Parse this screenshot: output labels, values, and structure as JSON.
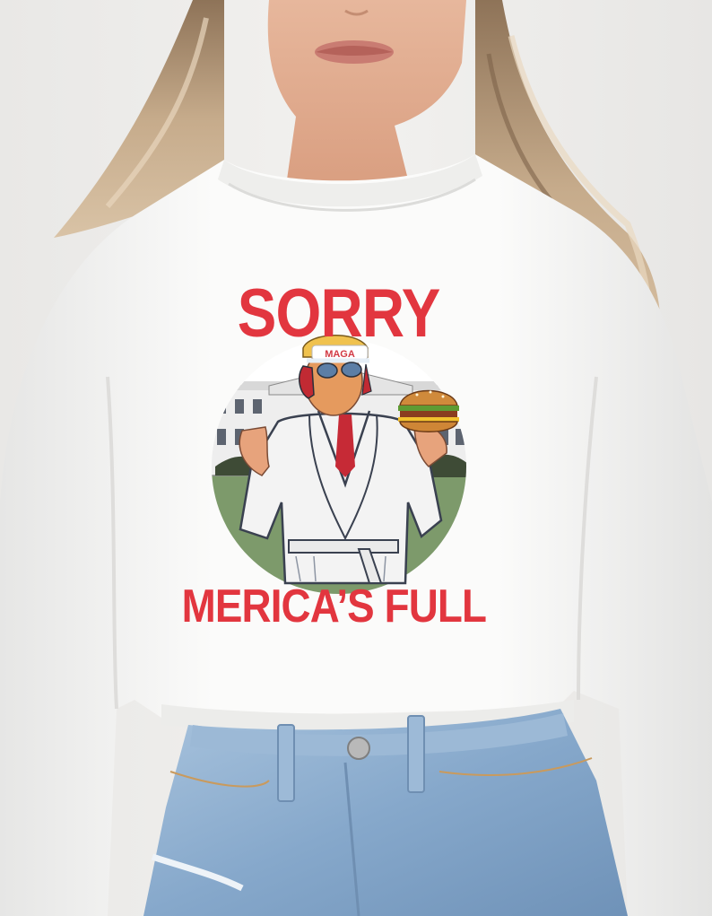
{
  "photo": {
    "subject": "model-wearing-white-sweatshirt",
    "print_line_1": "SORRY",
    "print_line_2": "MERICA’S FULL",
    "hat_text": "MAGA"
  },
  "colors": {
    "print_red": "#e2363f",
    "sweatshirt": "#f7f7f6",
    "denim": "#8fb0d2",
    "hair": "#b89b7c"
  }
}
